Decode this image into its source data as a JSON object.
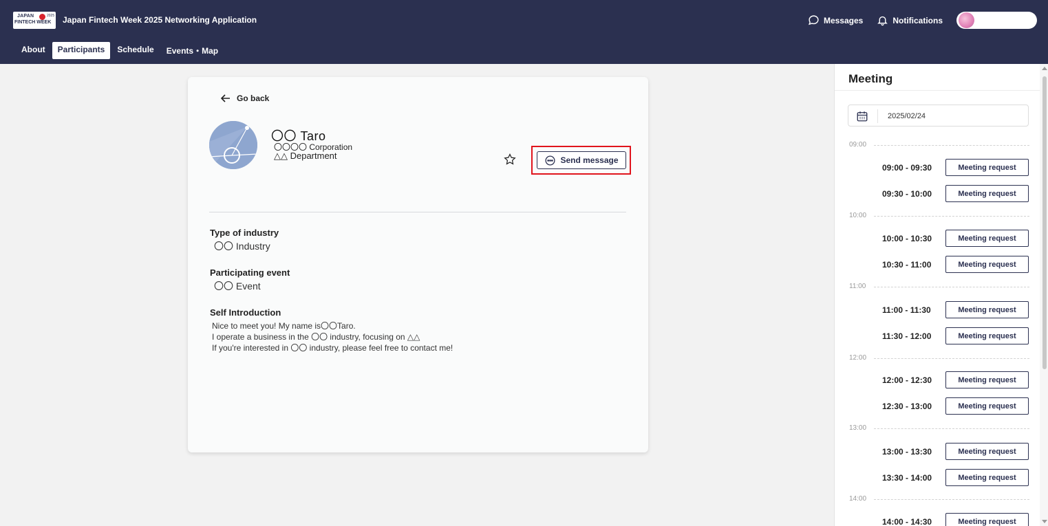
{
  "header": {
    "logo_line1": "JAPAN",
    "logo_line2": "FINTECH WEEK",
    "logo_year": "2025",
    "app_title": "Japan Fintech Week 2025 Networking Application",
    "messages_label": "Messages",
    "notifications_label": "Notifications",
    "brand_color": "#2b3050"
  },
  "nav": {
    "items": [
      "About",
      "Participants",
      "Schedule",
      "Events・Map"
    ],
    "active": "Participants"
  },
  "profile": {
    "go_back": "Go back",
    "name": "〇〇 Taro",
    "corporation": "〇〇〇〇 Corporation",
    "department": "△△ Department",
    "send_message": "Send message",
    "sections": {
      "industry_title": "Type of industry",
      "industry_value": "〇〇 Industry",
      "event_title": "Participating event",
      "event_value": "〇〇 Event",
      "intro_title": "Self Introduction",
      "intro_lines": [
        "Nice to meet you! My name is〇〇Taro.",
        "I operate a business in the 〇〇 industry, focusing on △△",
        "If you're interested in 〇〇 industry, please feel free to contact me!"
      ]
    },
    "highlight_color": "#e0141c"
  },
  "meeting": {
    "title": "Meeting",
    "date": "2025/02/24",
    "request_label": "Meeting request",
    "hours": [
      "09:00",
      "10:00",
      "11:00",
      "12:00",
      "13:00",
      "14:00"
    ],
    "slots": [
      "09:00 - 09:30",
      "09:30 - 10:00",
      "10:00 - 10:30",
      "10:30 - 11:00",
      "11:00 - 11:30",
      "11:30 - 12:00",
      "12:00 - 12:30",
      "12:30 - 13:00",
      "13:00 - 13:30",
      "13:30 - 14:00",
      "14:00 - 14:30"
    ]
  }
}
